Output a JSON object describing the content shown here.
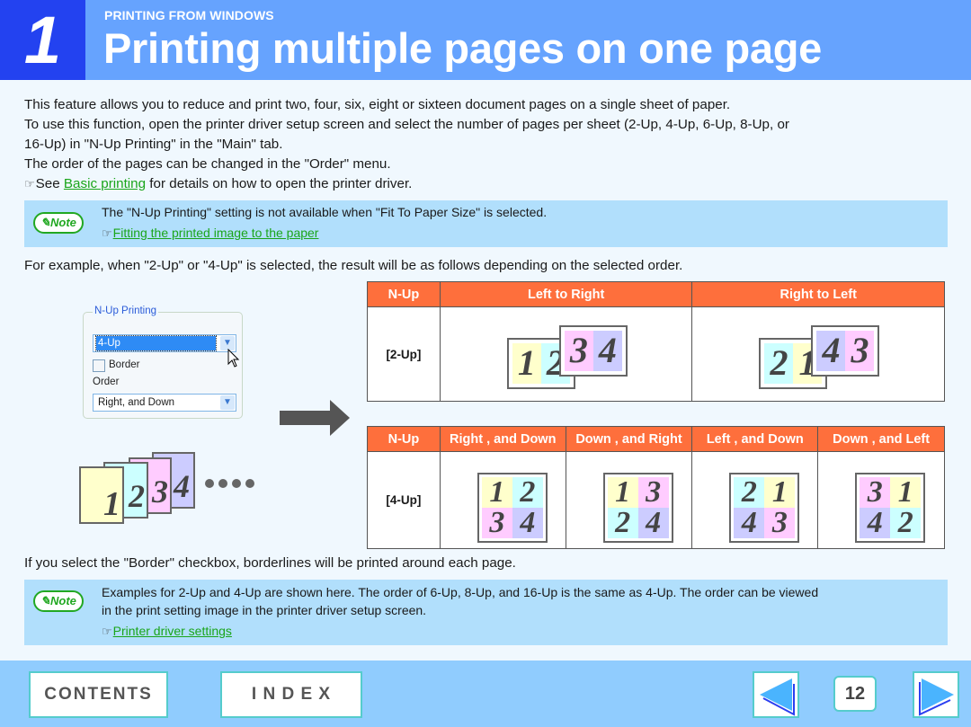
{
  "header": {
    "chapter_number": "1",
    "section": "PRINTING FROM WINDOWS",
    "title": "Printing multiple pages on one page"
  },
  "intro": {
    "line1": "This feature allows you to reduce and print two, four, six, eight or sixteen document pages on a single sheet of paper.",
    "line2": "To use this function, open the printer driver setup screen and select the number of pages per sheet (2-Up, 4-Up, 6-Up, 8-Up, or",
    "line3": "16-Up) in \"N-Up Printing\" in the \"Main\" tab.",
    "line4": "The order of the pages can be changed in the \"Order\" menu.",
    "see_prefix": "See ",
    "see_link": "Basic printing",
    "see_suffix": " for details on how to open the printer driver."
  },
  "note1": {
    "badge": "Note",
    "text": "The \"N-Up Printing\" setting is not available when \"Fit To Paper Size\" is selected.",
    "link": "Fitting the printed image to the paper"
  },
  "example_text": "For example, when \"2-Up\" or \"4-Up\" is selected, the result will be as follows depending on the selected order.",
  "dialog": {
    "group_label": "N-Up Printing",
    "nup_value": "4-Up",
    "border_label": "Border",
    "border_checked": false,
    "order_label": "Order",
    "order_value": "Right, and Down"
  },
  "table2up": {
    "headers": [
      "N-Up",
      "Left to Right",
      "Right to Left"
    ],
    "row_label": "[2-Up]",
    "left_to_right": {
      "sheet1": [
        "1",
        "2"
      ],
      "sheet2": [
        "3",
        "4"
      ]
    },
    "right_to_left": {
      "sheet1": [
        "2",
        "1"
      ],
      "sheet2": [
        "4",
        "3"
      ]
    }
  },
  "table4up": {
    "headers": [
      "N-Up",
      "Right , and Down",
      "Down , and Right",
      "Left , and Down",
      "Down , and Left"
    ],
    "row_label": "[4-Up]",
    "layouts": [
      [
        "1",
        "2",
        "3",
        "4"
      ],
      [
        "1",
        "3",
        "2",
        "4"
      ],
      [
        "2",
        "1",
        "4",
        "3"
      ],
      [
        "3",
        "1",
        "4",
        "2"
      ]
    ]
  },
  "source_pages": [
    "1",
    "2",
    "3",
    "4"
  ],
  "border_text": "If you select the \"Border\" checkbox, borderlines will be printed around each page.",
  "note2": {
    "badge": "Note",
    "line1": "Examples for 2-Up and 4-Up are shown here. The order of 6-Up, 8-Up, and 16-Up is the same as 4-Up. The order can be viewed",
    "line2": "in the print setting image in the printer driver setup screen.",
    "link": "Printer driver settings"
  },
  "footer": {
    "contents": "CONTENTS",
    "index": "I N D E X",
    "page_number": "12"
  },
  "colors": {
    "header_bg": "#66a3fe",
    "chapter_bg": "#2342f0",
    "table_header": "#fe6f3c",
    "note_bg": "#b1dffc",
    "link": "#1aa51a",
    "footer_bg": "#90ccfe"
  }
}
